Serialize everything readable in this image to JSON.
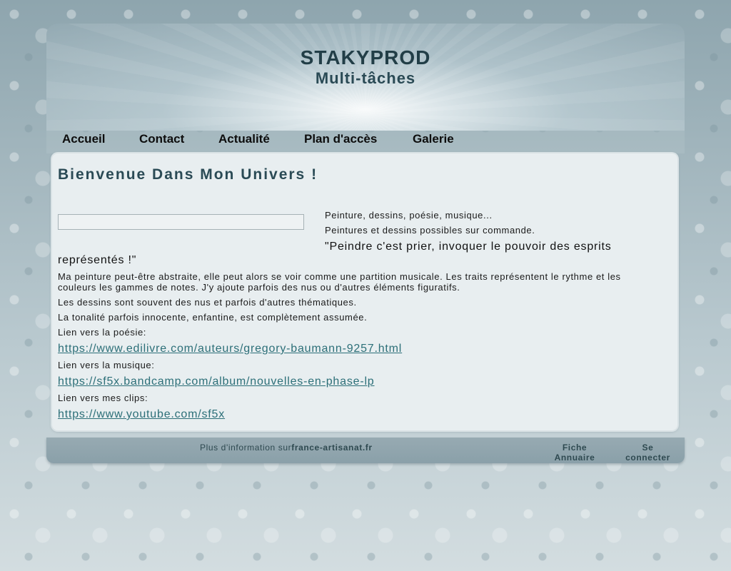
{
  "header": {
    "title": "STAKYPROD",
    "subtitle": "Multi-tâches"
  },
  "nav": {
    "items": [
      {
        "label": "Accueil"
      },
      {
        "label": "Contact"
      },
      {
        "label": "Actualité"
      },
      {
        "label": "Plan d'accès"
      },
      {
        "label": "Galerie"
      }
    ]
  },
  "main": {
    "heading": "Bienvenue Dans Mon Univers !",
    "intro_line1": "Peinture, dessins, poésie, musique...",
    "intro_line2": "Peintures et dessins possibles sur commande.",
    "quote_part1": "\"Peindre c'est prier, invoquer le pouvoir des esprits",
    "quote_part2": "représentés !\"",
    "paragraph1_line1": "Ma peinture peut-être abstraite, elle peut alors se voir comme une partition musicale. Les traits représentent le rythme et les",
    "paragraph1_line2": "couleurs les gammes de notes. J'y ajoute parfois des nus ou d'autres éléments figuratifs.",
    "paragraph2": "Les dessins sont souvent des nus et parfois d'autres thématiques.",
    "paragraph3": "La tonalité parfois innocente, enfantine, est complètement assumée.",
    "poetry_label": "Lien vers la poésie:",
    "poetry_link": "https://www.edilivre.com/auteurs/gregory-baumann-9257.html",
    "music_label": "Lien vers la musique:",
    "music_link": "https://sf5x.bandcamp.com/album/nouvelles-en-phase-lp",
    "clips_label": "Lien vers mes clips:",
    "clips_link": "https://www.youtube.com/sf5x"
  },
  "footer": {
    "info_prefix": "Plus d'information sur",
    "info_site": "france-artisanat.fr",
    "annuaire_line1": "Fiche",
    "annuaire_line2": "Annuaire",
    "login_line1": "Se",
    "login_line2": "connecter"
  },
  "colors": {
    "heading": "#2a4a55",
    "link": "#2c6f78",
    "content_bg": "#e8eef0"
  }
}
